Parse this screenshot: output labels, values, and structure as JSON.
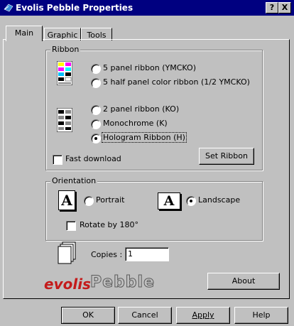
{
  "window": {
    "title": "Evolis Pebble Properties",
    "help_btn": "?",
    "close_btn": "X"
  },
  "tabs": [
    {
      "label": "Main",
      "selected": true
    },
    {
      "label": "Graphic",
      "selected": false
    },
    {
      "label": "Tools",
      "selected": false
    }
  ],
  "ribbon": {
    "group_label": "Ribbon",
    "options": [
      {
        "label": "5 panel ribbon (YMCKO)",
        "selected": false
      },
      {
        "label": "5 half panel color ribbon (1/2 YMCKO)",
        "selected": false
      },
      {
        "label": "2 panel ribbon (KO)",
        "selected": false
      },
      {
        "label": "Monochrome (K)",
        "selected": false
      },
      {
        "label": "Hologram Ribbon (H)",
        "selected": true
      }
    ],
    "fast_download": {
      "label": "Fast download",
      "checked": false
    },
    "set_button": "Set Ribbon"
  },
  "orientation": {
    "group_label": "Orientation",
    "portrait_icon": "A",
    "landscape_icon": "A",
    "portrait": {
      "label": "Portrait",
      "selected": false
    },
    "landscape": {
      "label": "Landscape",
      "selected": true
    },
    "rotate": {
      "label": "Rotate by 180°",
      "checked": false
    }
  },
  "copies": {
    "label": "Copies :",
    "value": "1"
  },
  "about_button": "About",
  "logo": {
    "brand": "evolis",
    "product": "Pebble"
  },
  "footer": {
    "ok": "OK",
    "cancel": "Cancel",
    "apply": "Apply",
    "help": "Help"
  },
  "colors": {
    "titlebar": "#000080",
    "face": "#c0c0c0",
    "brand": "#c41b1b"
  }
}
